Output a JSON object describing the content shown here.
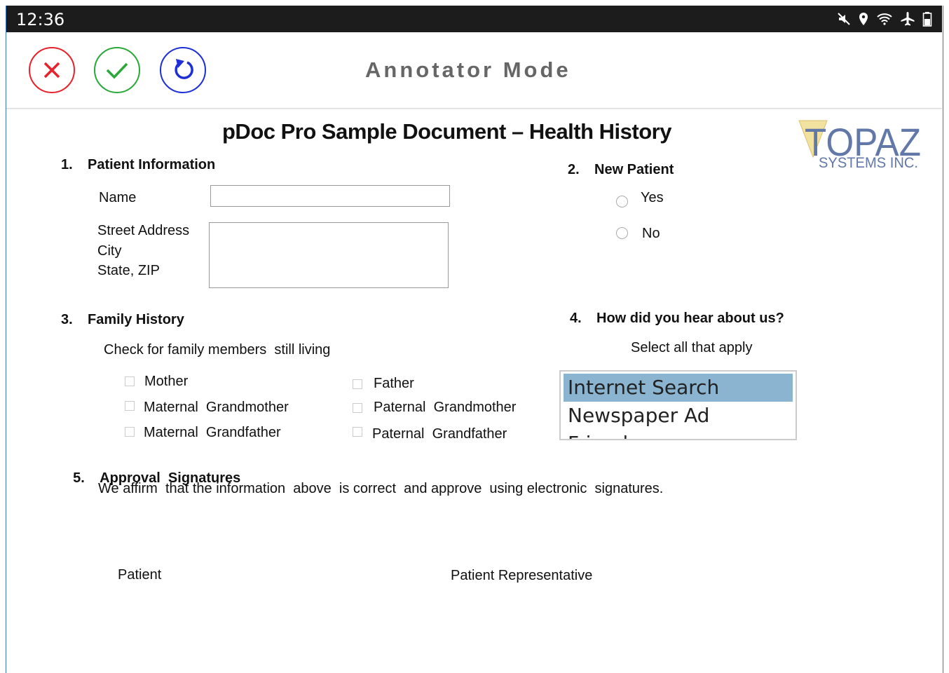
{
  "status_bar": {
    "time": "12:36",
    "icons": [
      "mute-icon",
      "location-icon",
      "wifi-icon",
      "airplane-icon",
      "battery-icon"
    ]
  },
  "app_bar": {
    "title": "Annotator Mode",
    "buttons": [
      "cancel",
      "confirm",
      "undo"
    ]
  },
  "document": {
    "title": "pDoc Pro Sample Document – Health History",
    "logo": {
      "line1": "TOPAZ",
      "line2": "SYSTEMS INC."
    },
    "section1": {
      "num": "1.",
      "title": "Patient Information",
      "name_label": "Name",
      "address_lines": [
        "Street Address",
        "City",
        "State, ZIP"
      ],
      "name_value": "",
      "address_value": ""
    },
    "section2": {
      "num": "2.",
      "title": "New Patient",
      "options": [
        "Yes",
        "No"
      ]
    },
    "section3": {
      "num": "3.",
      "title": "Family History",
      "instruction": "Check for family members  still living",
      "left": [
        "Mother",
        "Maternal  Grandmother",
        "Maternal  Grandfather"
      ],
      "right": [
        "Father",
        "Paternal  Grandmother",
        "Paternal  Grandfather"
      ]
    },
    "section4": {
      "num": "4.",
      "title": "How did you hear about us?",
      "instruction": "Select all that apply",
      "options": [
        "Internet Search",
        "Newspaper Ad",
        "Friend"
      ],
      "selected": "Internet Search"
    },
    "section5": {
      "num": "5.",
      "title": "Approval  Signatures",
      "statement": "We affirm  that the information  above  is correct  and approve  using electronic  signatures.",
      "sig_patient": "Patient",
      "sig_rep": "Patient Representative"
    }
  },
  "colors": {
    "cancel": "#e8212a",
    "confirm": "#2aa83a",
    "undo": "#1d2fd6",
    "list_selected": "#8ab4d0",
    "frame": "#3b73c8",
    "logo": "#6178a8"
  }
}
